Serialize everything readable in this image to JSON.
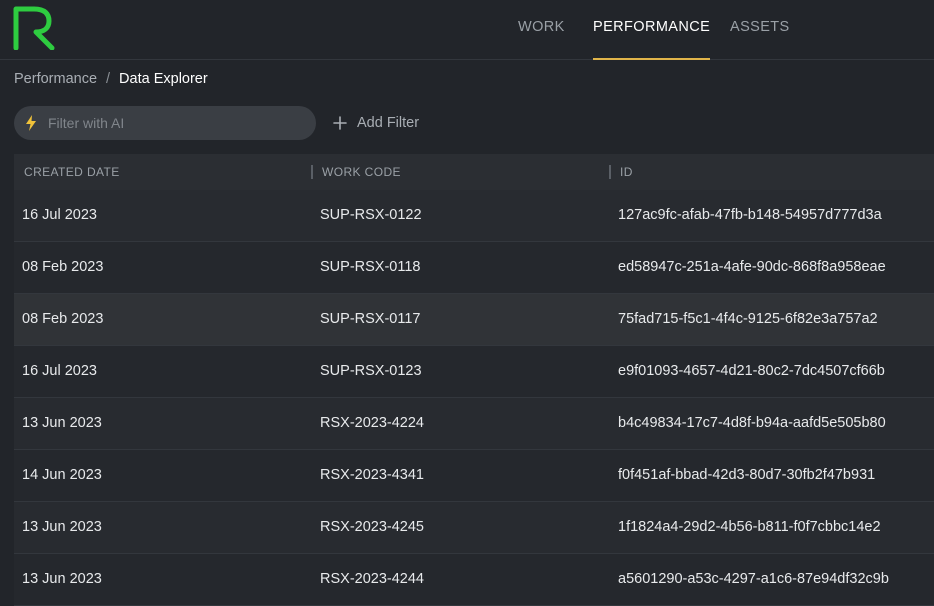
{
  "nav": {
    "items": [
      {
        "label": "WORK",
        "active": false
      },
      {
        "label": "PERFORMANCE",
        "active": true
      },
      {
        "label": "ASSETS",
        "active": false
      }
    ]
  },
  "breadcrumb": {
    "parent": "Performance",
    "separator": "/",
    "current": "Data Explorer"
  },
  "filter": {
    "placeholder": "Filter with AI",
    "icon": "lightning-bolt-icon",
    "add_label": "Add Filter"
  },
  "colors": {
    "accent": "#e0b54a",
    "logo": "#2ecc40",
    "bolt": "#f0c23a"
  },
  "table": {
    "columns": [
      "CREATED DATE",
      "WORK CODE",
      "ID"
    ],
    "rows": [
      {
        "created_date": "16 Jul 2023",
        "work_code": "SUP-RSX-0122",
        "id": "127ac9fc-afab-47fb-b148-54957d777d3a"
      },
      {
        "created_date": "08 Feb 2023",
        "work_code": "SUP-RSX-0118",
        "id": "ed58947c-251a-4afe-90dc-868f8a958eae"
      },
      {
        "created_date": "08 Feb 2023",
        "work_code": "SUP-RSX-0117",
        "id": "75fad715-f5c1-4f4c-9125-6f82e3a757a2"
      },
      {
        "created_date": "16 Jul 2023",
        "work_code": "SUP-RSX-0123",
        "id": "e9f01093-4657-4d21-80c2-7dc4507cf66b"
      },
      {
        "created_date": "13 Jun 2023",
        "work_code": "RSX-2023-4224",
        "id": "b4c49834-17c7-4d8f-b94a-aafd5e505b80"
      },
      {
        "created_date": "14 Jun 2023",
        "work_code": "RSX-2023-4341",
        "id": "f0f451af-bbad-42d3-80d7-30fb2f47b931"
      },
      {
        "created_date": "13 Jun 2023",
        "work_code": "RSX-2023-4245",
        "id": "1f1824a4-29d2-4b56-b811-f0f7cbbc14e2"
      },
      {
        "created_date": "13 Jun 2023",
        "work_code": "RSX-2023-4244",
        "id": "a5601290-a53c-4297-a1c6-87e94df32c9b"
      }
    ]
  }
}
